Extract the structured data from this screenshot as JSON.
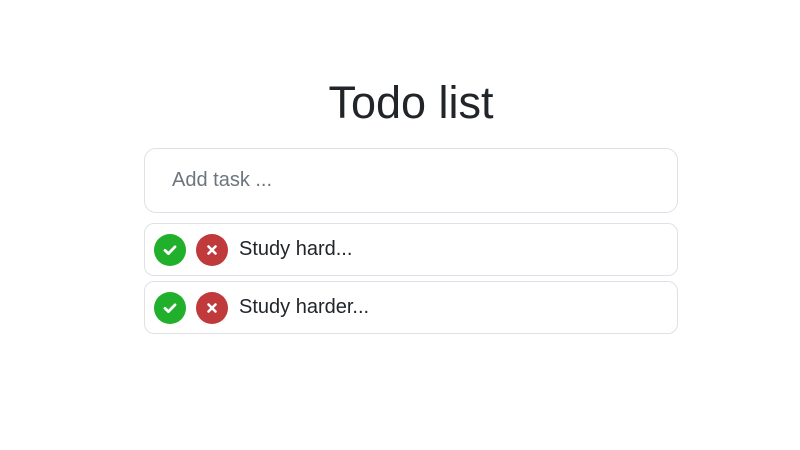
{
  "app": {
    "title": "Todo list"
  },
  "add_task": {
    "placeholder": "Add task ...",
    "value": ""
  },
  "tasks": [
    {
      "label": "Study hard..."
    },
    {
      "label": "Study harder..."
    }
  ],
  "colors": {
    "complete": "#20b02b",
    "delete": "#c0393b",
    "border": "#dee2e6",
    "text": "#212529"
  },
  "icons": {
    "complete": "check-icon",
    "delete": "close-icon"
  }
}
